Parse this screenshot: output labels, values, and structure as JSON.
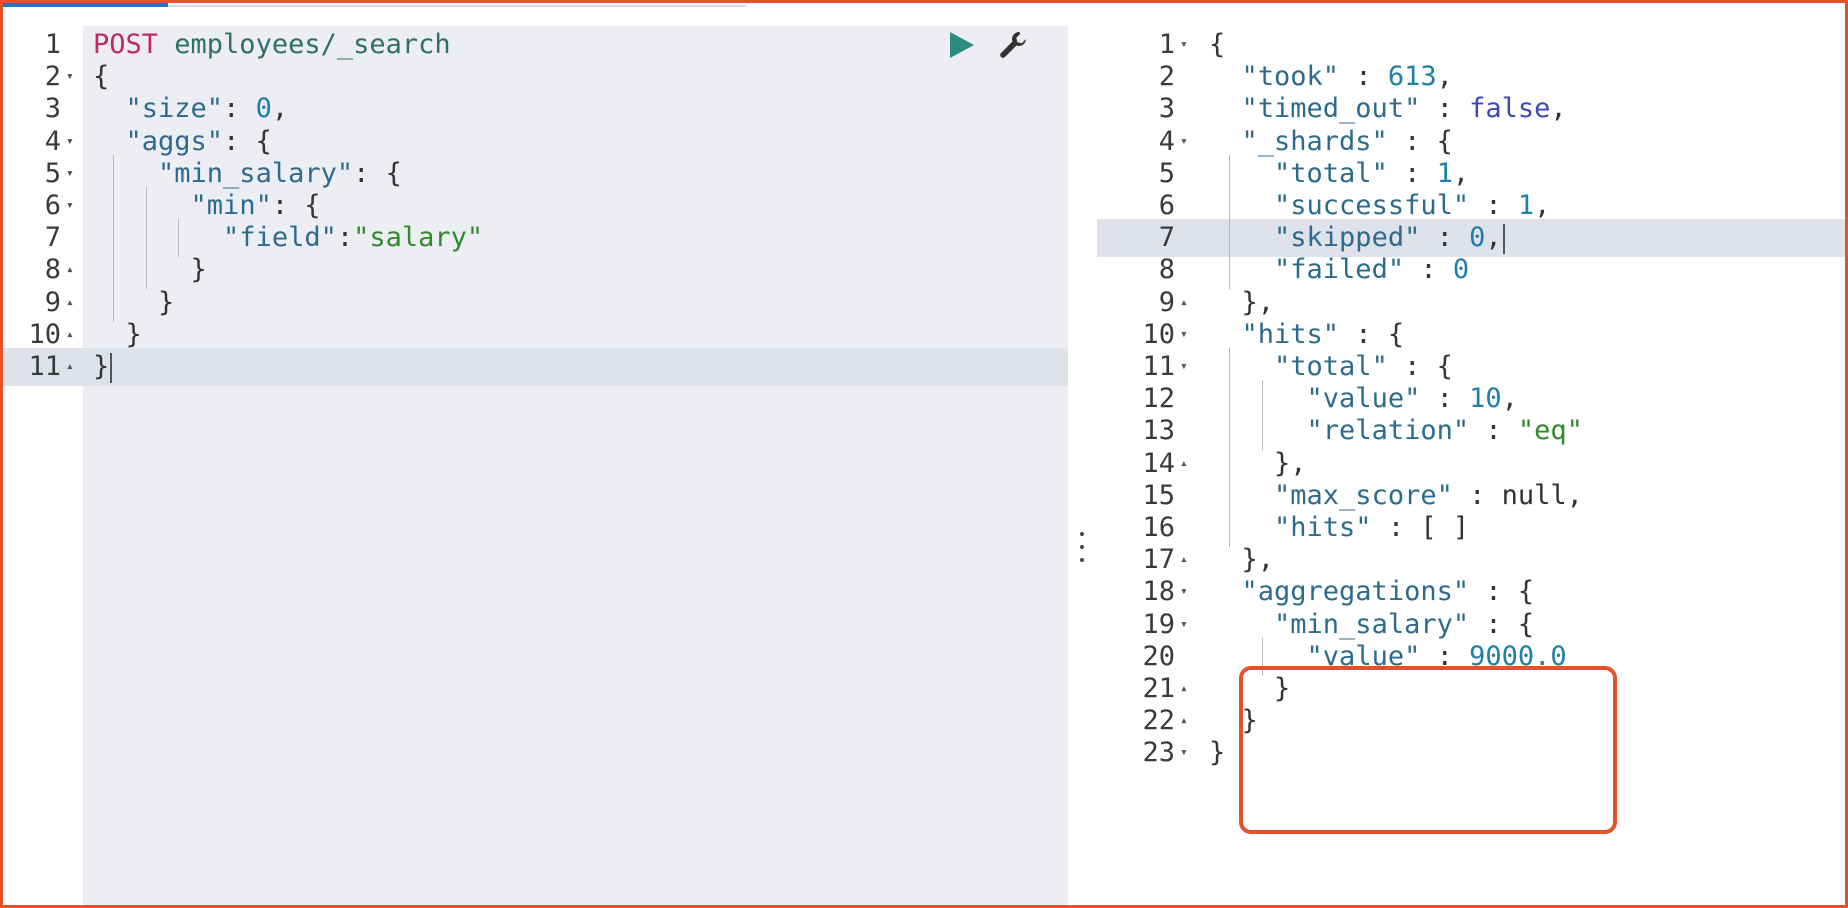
{
  "request": {
    "method": "POST",
    "url": " employees/_search",
    "lines": [
      {
        "n": "1",
        "fold": "",
        "parts": [
          {
            "t": "POST",
            "c": "c-method"
          },
          {
            "t": " employees/_search",
            "c": "c-url"
          }
        ],
        "guides": []
      },
      {
        "n": "2",
        "fold": "▾",
        "parts": [
          {
            "t": "{",
            "c": "c-punc"
          }
        ],
        "guides": []
      },
      {
        "n": "3",
        "fold": "",
        "parts": [
          {
            "t": "  ",
            "c": "c-punc"
          },
          {
            "t": "\"size\"",
            "c": "c-key"
          },
          {
            "t": ": ",
            "c": "c-punc"
          },
          {
            "t": "0",
            "c": "c-num"
          },
          {
            "t": ",",
            "c": "c-punc"
          }
        ],
        "guides": []
      },
      {
        "n": "4",
        "fold": "▾",
        "parts": [
          {
            "t": "  ",
            "c": "c-punc"
          },
          {
            "t": "\"aggs\"",
            "c": "c-key"
          },
          {
            "t": ": {",
            "c": "c-punc"
          }
        ],
        "guides": []
      },
      {
        "n": "5",
        "fold": "▾",
        "parts": [
          {
            "t": "    ",
            "c": "c-punc"
          },
          {
            "t": "\"min_salary\"",
            "c": "c-key"
          },
          {
            "t": ": {",
            "c": "c-punc"
          }
        ],
        "guides": [
          1
        ]
      },
      {
        "n": "6",
        "fold": "▾",
        "parts": [
          {
            "t": "      ",
            "c": "c-punc"
          },
          {
            "t": "\"min\"",
            "c": "c-key"
          },
          {
            "t": ": {",
            "c": "c-punc"
          }
        ],
        "guides": [
          1,
          2
        ]
      },
      {
        "n": "7",
        "fold": "",
        "parts": [
          {
            "t": "        ",
            "c": "c-punc"
          },
          {
            "t": "\"field\"",
            "c": "c-key"
          },
          {
            "t": ":",
            "c": "c-punc"
          },
          {
            "t": "\"salary\"",
            "c": "c-str"
          }
        ],
        "guides": [
          1,
          2,
          3
        ]
      },
      {
        "n": "8",
        "fold": "▴",
        "parts": [
          {
            "t": "      }",
            "c": "c-punc"
          }
        ],
        "guides": [
          1,
          2
        ]
      },
      {
        "n": "9",
        "fold": "▴",
        "parts": [
          {
            "t": "    }",
            "c": "c-punc"
          }
        ],
        "guides": [
          1
        ]
      },
      {
        "n": "10",
        "fold": "▴",
        "parts": [
          {
            "t": "  }",
            "c": "c-punc"
          }
        ],
        "guides": []
      },
      {
        "n": "11",
        "fold": "▴",
        "parts": [
          {
            "t": "}",
            "c": "c-punc"
          }
        ],
        "guides": [],
        "active": true,
        "cursor": true
      }
    ]
  },
  "response": {
    "lines": [
      {
        "n": "1",
        "fold": "▾",
        "parts": [
          {
            "t": "{",
            "c": "c-punc"
          }
        ],
        "guides": []
      },
      {
        "n": "2",
        "fold": "",
        "parts": [
          {
            "t": "  ",
            "c": "c-punc"
          },
          {
            "t": "\"took\"",
            "c": "c-key"
          },
          {
            "t": " : ",
            "c": "c-punc"
          },
          {
            "t": "613",
            "c": "c-num"
          },
          {
            "t": ",",
            "c": "c-punc"
          }
        ],
        "guides": []
      },
      {
        "n": "3",
        "fold": "",
        "parts": [
          {
            "t": "  ",
            "c": "c-punc"
          },
          {
            "t": "\"timed_out\"",
            "c": "c-key"
          },
          {
            "t": " : ",
            "c": "c-punc"
          },
          {
            "t": "false",
            "c": "c-bool"
          },
          {
            "t": ",",
            "c": "c-punc"
          }
        ],
        "guides": []
      },
      {
        "n": "4",
        "fold": "▾",
        "parts": [
          {
            "t": "  ",
            "c": "c-punc"
          },
          {
            "t": "\"_shards\"",
            "c": "c-key"
          },
          {
            "t": " : {",
            "c": "c-punc"
          }
        ],
        "guides": []
      },
      {
        "n": "5",
        "fold": "",
        "parts": [
          {
            "t": "    ",
            "c": "c-punc"
          },
          {
            "t": "\"total\"",
            "c": "c-key"
          },
          {
            "t": " : ",
            "c": "c-punc"
          },
          {
            "t": "1",
            "c": "c-num"
          },
          {
            "t": ",",
            "c": "c-punc"
          }
        ],
        "guides": [
          1
        ]
      },
      {
        "n": "6",
        "fold": "",
        "parts": [
          {
            "t": "    ",
            "c": "c-punc"
          },
          {
            "t": "\"successful\"",
            "c": "c-key"
          },
          {
            "t": " : ",
            "c": "c-punc"
          },
          {
            "t": "1",
            "c": "c-num"
          },
          {
            "t": ",",
            "c": "c-punc"
          }
        ],
        "guides": [
          1
        ]
      },
      {
        "n": "7",
        "fold": "",
        "parts": [
          {
            "t": "    ",
            "c": "c-punc"
          },
          {
            "t": "\"skipped\"",
            "c": "c-key"
          },
          {
            "t": " : ",
            "c": "c-punc"
          },
          {
            "t": "0",
            "c": "c-num"
          },
          {
            "t": ",",
            "c": "c-punc"
          }
        ],
        "guides": [
          1
        ],
        "active": true,
        "cursor": true
      },
      {
        "n": "8",
        "fold": "",
        "parts": [
          {
            "t": "    ",
            "c": "c-punc"
          },
          {
            "t": "\"failed\"",
            "c": "c-key"
          },
          {
            "t": " : ",
            "c": "c-punc"
          },
          {
            "t": "0",
            "c": "c-num"
          }
        ],
        "guides": [
          1
        ]
      },
      {
        "n": "9",
        "fold": "▴",
        "parts": [
          {
            "t": "  },",
            "c": "c-punc"
          }
        ],
        "guides": []
      },
      {
        "n": "10",
        "fold": "▾",
        "parts": [
          {
            "t": "  ",
            "c": "c-punc"
          },
          {
            "t": "\"hits\"",
            "c": "c-key"
          },
          {
            "t": " : {",
            "c": "c-punc"
          }
        ],
        "guides": []
      },
      {
        "n": "11",
        "fold": "▾",
        "parts": [
          {
            "t": "    ",
            "c": "c-punc"
          },
          {
            "t": "\"total\"",
            "c": "c-key"
          },
          {
            "t": " : {",
            "c": "c-punc"
          }
        ],
        "guides": [
          1
        ]
      },
      {
        "n": "12",
        "fold": "",
        "parts": [
          {
            "t": "      ",
            "c": "c-punc"
          },
          {
            "t": "\"value\"",
            "c": "c-key"
          },
          {
            "t": " : ",
            "c": "c-punc"
          },
          {
            "t": "10",
            "c": "c-num"
          },
          {
            "t": ",",
            "c": "c-punc"
          }
        ],
        "guides": [
          1,
          2
        ]
      },
      {
        "n": "13",
        "fold": "",
        "parts": [
          {
            "t": "      ",
            "c": "c-punc"
          },
          {
            "t": "\"relation\"",
            "c": "c-key"
          },
          {
            "t": " : ",
            "c": "c-punc"
          },
          {
            "t": "\"eq\"",
            "c": "c-str"
          }
        ],
        "guides": [
          1,
          2
        ]
      },
      {
        "n": "14",
        "fold": "▴",
        "parts": [
          {
            "t": "    },",
            "c": "c-punc"
          }
        ],
        "guides": [
          1
        ]
      },
      {
        "n": "15",
        "fold": "",
        "parts": [
          {
            "t": "    ",
            "c": "c-punc"
          },
          {
            "t": "\"max_score\"",
            "c": "c-key"
          },
          {
            "t": " : null,",
            "c": "c-null"
          }
        ],
        "guides": [
          1
        ]
      },
      {
        "n": "16",
        "fold": "",
        "parts": [
          {
            "t": "    ",
            "c": "c-punc"
          },
          {
            "t": "\"hits\"",
            "c": "c-key"
          },
          {
            "t": " : [ ]",
            "c": "c-punc"
          }
        ],
        "guides": [
          1
        ]
      },
      {
        "n": "17",
        "fold": "▴",
        "parts": [
          {
            "t": "  },",
            "c": "c-punc"
          }
        ],
        "guides": []
      },
      {
        "n": "18",
        "fold": "▾",
        "parts": [
          {
            "t": "  ",
            "c": "c-punc"
          },
          {
            "t": "\"aggregations\"",
            "c": "c-key"
          },
          {
            "t": " : {",
            "c": "c-punc"
          }
        ],
        "guides": []
      },
      {
        "n": "19",
        "fold": "▾",
        "parts": [
          {
            "t": "    ",
            "c": "c-punc"
          },
          {
            "t": "\"min_salary\"",
            "c": "c-key"
          },
          {
            "t": " : {",
            "c": "c-punc"
          }
        ],
        "guides": []
      },
      {
        "n": "20",
        "fold": "",
        "parts": [
          {
            "t": "      ",
            "c": "c-punc"
          },
          {
            "t": "\"value\"",
            "c": "c-key"
          },
          {
            "t": " : ",
            "c": "c-punc"
          },
          {
            "t": "9000.0",
            "c": "c-num"
          }
        ],
        "guides": [
          2
        ]
      },
      {
        "n": "21",
        "fold": "▴",
        "parts": [
          {
            "t": "    }",
            "c": "c-punc"
          }
        ],
        "guides": []
      },
      {
        "n": "22",
        "fold": "▴",
        "parts": [
          {
            "t": "  }",
            "c": "c-punc"
          }
        ],
        "guides": []
      },
      {
        "n": "23",
        "fold": "▾",
        "parts": [
          {
            "t": "}",
            "c": "c-punc"
          }
        ],
        "guides": []
      }
    ]
  },
  "toolbar": {
    "run_icon": "play-icon",
    "settings_icon": "wrench-icon"
  },
  "colors": {
    "accent_border": "#e4512d",
    "progress": "#2b6fbd",
    "run_button": "#2c8c80"
  }
}
